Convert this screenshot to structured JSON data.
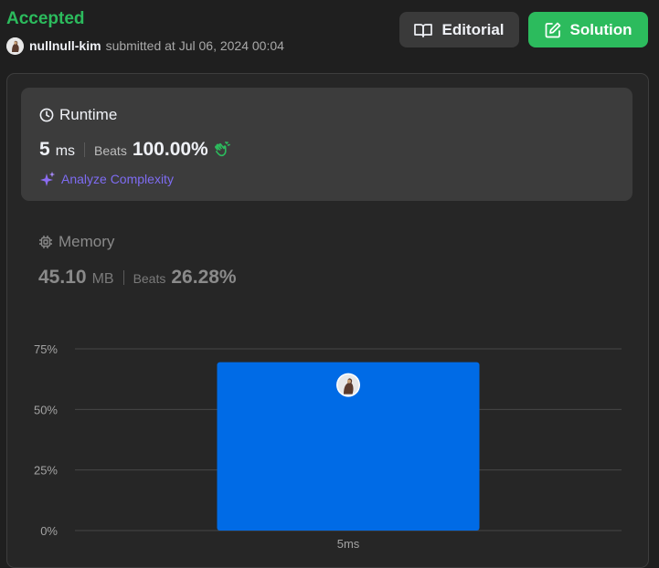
{
  "status": "Accepted",
  "submitter": {
    "username": "nullnull-kim",
    "submitted_text": "submitted at Jul 06, 2024 00:04"
  },
  "buttons": {
    "editorial": "Editorial",
    "solution": "Solution"
  },
  "runtime": {
    "label": "Runtime",
    "value": "5",
    "unit": "ms",
    "beats_label": "Beats",
    "beats_value": "100.00%"
  },
  "analyze_label": "Analyze Complexity",
  "memory": {
    "label": "Memory",
    "value": "45.10",
    "unit": "MB",
    "beats_label": "Beats",
    "beats_value": "26.28%"
  },
  "colors": {
    "accepted": "#2cbb5d",
    "bar": "#006be6",
    "analyze": "#7e6cf2"
  },
  "icons": {
    "editorial": "book-open-icon",
    "solution": "edit-icon",
    "runtime": "clock-icon",
    "memory": "chip-icon",
    "analyze": "sparkle-icon",
    "beats": "clap-icon"
  },
  "chart_data": {
    "type": "bar",
    "categories": [
      "5ms"
    ],
    "values": [
      69.5
    ],
    "yticks": [
      "0%",
      "25%",
      "50%",
      "75%"
    ],
    "ylim": [
      0,
      75
    ],
    "grid": true,
    "title": "",
    "xlabel": "",
    "ylabel": ""
  }
}
